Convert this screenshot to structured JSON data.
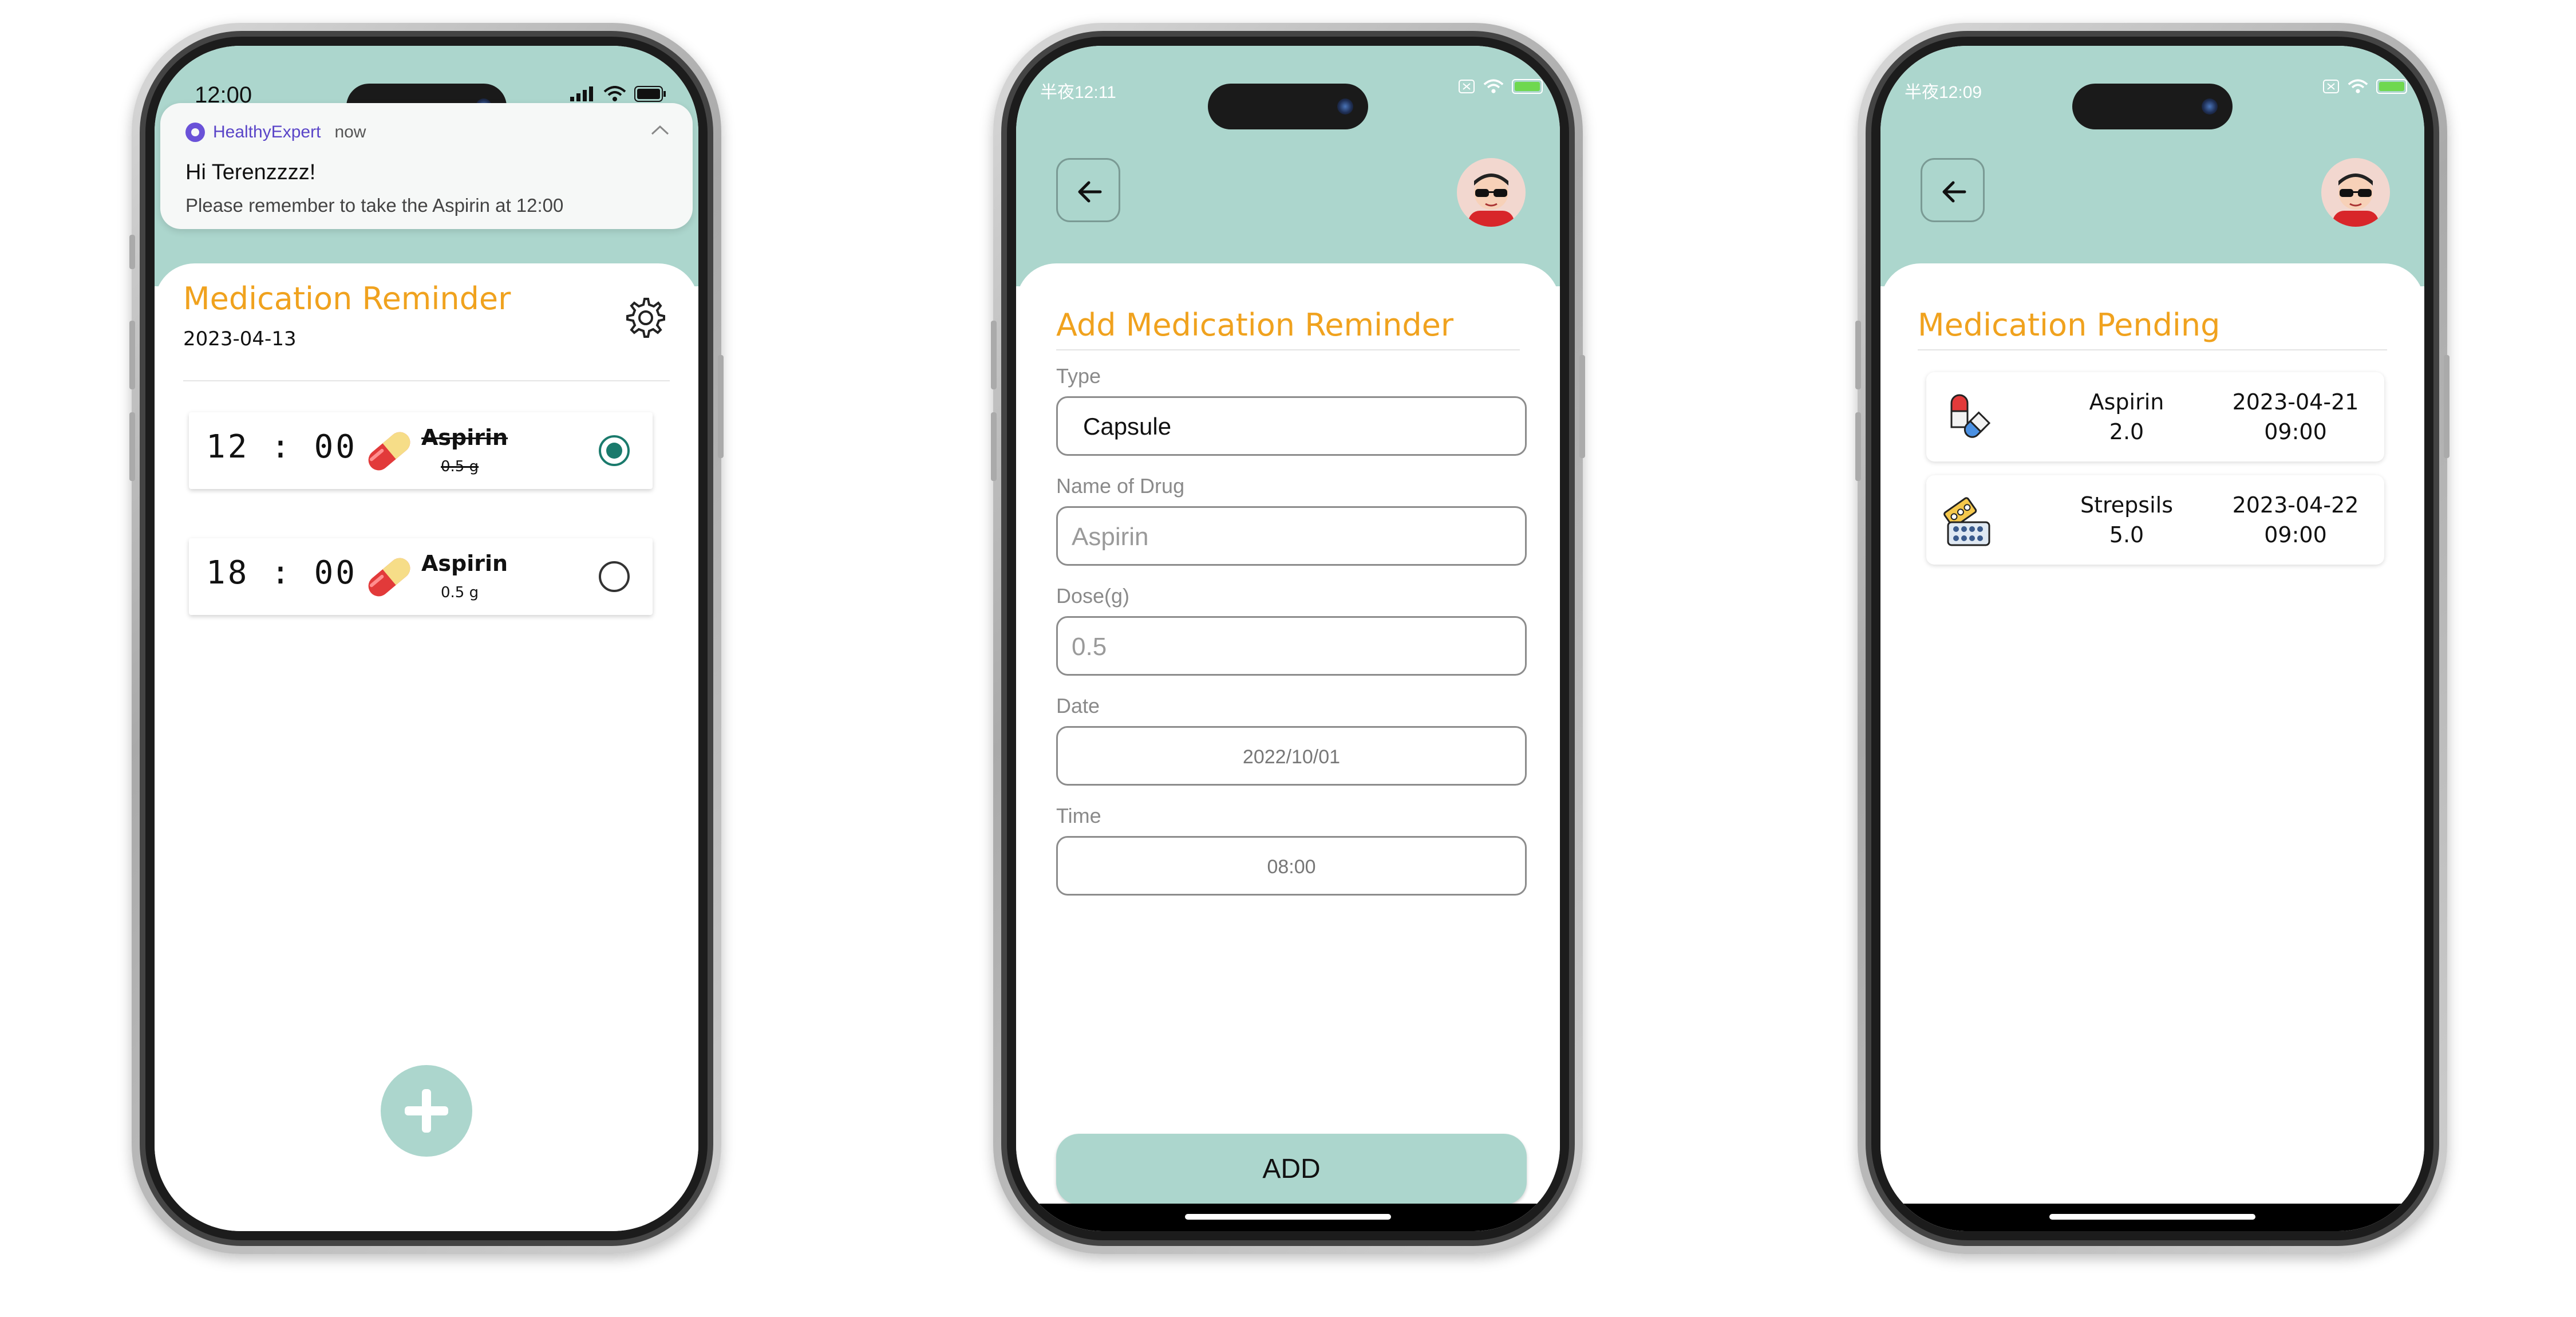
{
  "phone1": {
    "status_time": "12:00",
    "notification": {
      "app_name": "HealthyExpert",
      "time": "now",
      "title": "Hi Terenzzzz!",
      "body": "Please remember to take the Aspirin at 12:00"
    },
    "title": "Medication Reminder",
    "date": "2023-04-13",
    "reminders": [
      {
        "time": "12 : 00",
        "name": "Aspirin",
        "dose": "0.5 g",
        "taken": true
      },
      {
        "time": "18 : 00",
        "name": "Aspirin",
        "dose": "0.5 g",
        "taken": false
      }
    ],
    "icons": {
      "settings": "gear-icon",
      "add": "plus-icon",
      "pill": "capsule-icon"
    }
  },
  "phone2": {
    "status_time": "半夜12:11",
    "title": "Add Medication Reminder",
    "fields": {
      "type": {
        "label": "Type",
        "value": "Capsule"
      },
      "name": {
        "label": "Name of Drug",
        "placeholder": "Aspirin"
      },
      "dose": {
        "label": "Dose(g)",
        "placeholder": "0.5"
      },
      "date": {
        "label": "Date",
        "value": "2022/10/01"
      },
      "time": {
        "label": "Time",
        "value": "08:00"
      }
    },
    "add_label": "ADD",
    "icons": {
      "back": "arrow-left-icon",
      "avatar": "avatar-icon"
    }
  },
  "phone3": {
    "status_time": "半夜12:09",
    "title": "Medication Pending",
    "items": [
      {
        "name": "Aspirin",
        "dose": "2.0",
        "date": "2023-04-21",
        "time": "09:00",
        "icon": "capsule-pills-icon"
      },
      {
        "name": "Strepsils",
        "dose": "5.0",
        "date": "2023-04-22",
        "time": "09:00",
        "icon": "blister-pack-icon"
      }
    ]
  },
  "colors": {
    "accent": "#f0a21e",
    "header": "#acd6cd",
    "radio_on": "#1a7a6c",
    "app_name": "#5a45c8"
  }
}
